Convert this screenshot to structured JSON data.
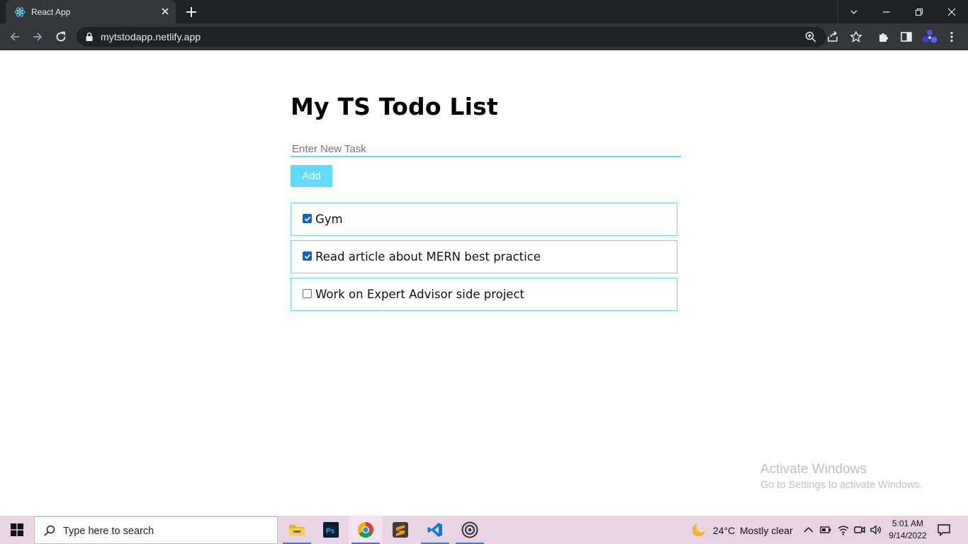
{
  "browser": {
    "tab_title": "React App",
    "url": "mytstodapp.netlify.app"
  },
  "page": {
    "title": "My TS Todo List",
    "input_placeholder": "Enter New Task",
    "add_label": "Add",
    "todos": [
      {
        "text": "Gym",
        "done": true
      },
      {
        "text": "Read article about MERN best practice",
        "done": true
      },
      {
        "text": "Work on Expert Advisor side project",
        "done": false
      }
    ]
  },
  "watermark": {
    "title": "Activate Windows",
    "subtitle": "Go to Settings to activate Windows."
  },
  "taskbar": {
    "search_placeholder": "Type here to search",
    "apps": [
      "file-explorer",
      "photoshop",
      "chrome",
      "sublime-text",
      "vs-code",
      "obs-studio"
    ],
    "weather_temp": "24°C",
    "weather_desc": "Mostly clear",
    "time": "5:01 AM",
    "date": "9/14/2022"
  },
  "colors": {
    "accent": "#61dafb",
    "checkbox": "#0b63d1",
    "taskbar_bg": "#e7d3e1",
    "chrome_dark": "#202124",
    "chrome_toolbar": "#35363a"
  }
}
